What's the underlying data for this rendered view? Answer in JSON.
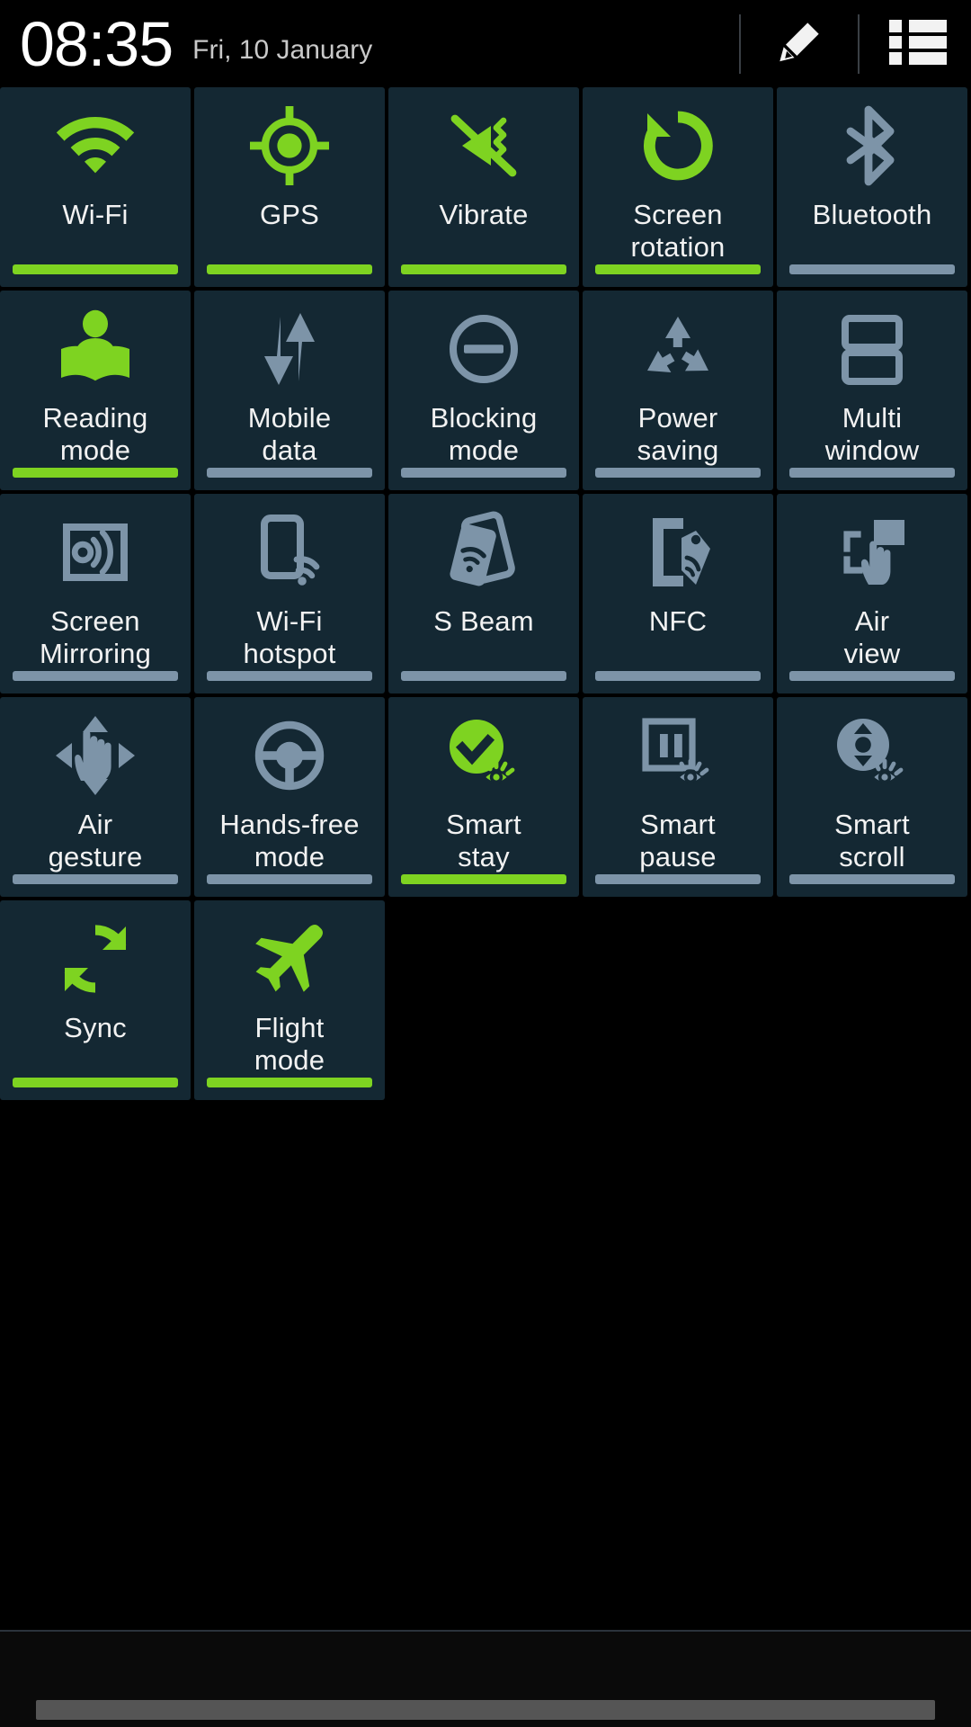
{
  "header": {
    "time": "08:35",
    "date": "Fri, 10 January",
    "edit_icon": "pencil-icon",
    "list_icon": "list-icon"
  },
  "colors": {
    "accent_on": "#7ed321",
    "accent_off": "#7d94a8",
    "tile_bg": "#142833",
    "screen_bg": "#000000",
    "label": "#f2f2f2",
    "date": "#c9c9c9"
  },
  "quick_settings": {
    "columns": 5,
    "tiles": [
      {
        "label": "Wi-Fi",
        "icon": "wifi-icon",
        "state": "on"
      },
      {
        "label": "GPS",
        "icon": "gps-icon",
        "state": "on"
      },
      {
        "label": "Vibrate",
        "icon": "vibrate-icon",
        "state": "on"
      },
      {
        "label": "Screen\nrotation",
        "icon": "screen-rotation-icon",
        "state": "on"
      },
      {
        "label": "Bluetooth",
        "icon": "bluetooth-icon",
        "state": "off"
      },
      {
        "label": "Reading\nmode",
        "icon": "reading-mode-icon",
        "state": "on"
      },
      {
        "label": "Mobile\ndata",
        "icon": "mobile-data-icon",
        "state": "off"
      },
      {
        "label": "Blocking\nmode",
        "icon": "blocking-mode-icon",
        "state": "off"
      },
      {
        "label": "Power\nsaving",
        "icon": "power-saving-icon",
        "state": "off"
      },
      {
        "label": "Multi\nwindow",
        "icon": "multi-window-icon",
        "state": "off"
      },
      {
        "label": "Screen\nMirroring",
        "icon": "screen-mirroring-icon",
        "state": "off"
      },
      {
        "label": "Wi-Fi\nhotspot",
        "icon": "wifi-hotspot-icon",
        "state": "off"
      },
      {
        "label": "S Beam",
        "icon": "s-beam-icon",
        "state": "off"
      },
      {
        "label": "NFC",
        "icon": "nfc-icon",
        "state": "off"
      },
      {
        "label": "Air\nview",
        "icon": "air-view-icon",
        "state": "off"
      },
      {
        "label": "Air\ngesture",
        "icon": "air-gesture-icon",
        "state": "off"
      },
      {
        "label": "Hands-free\nmode",
        "icon": "hands-free-icon",
        "state": "off"
      },
      {
        "label": "Smart\nstay",
        "icon": "smart-stay-icon",
        "state": "on"
      },
      {
        "label": "Smart\npause",
        "icon": "smart-pause-icon",
        "state": "off"
      },
      {
        "label": "Smart\nscroll",
        "icon": "smart-scroll-icon",
        "state": "off"
      },
      {
        "label": "Sync",
        "icon": "sync-icon",
        "state": "on"
      },
      {
        "label": "Flight\nmode",
        "icon": "flight-mode-icon",
        "state": "on"
      }
    ]
  },
  "bottom": {
    "drag_handle": "panel-drag-handle"
  }
}
